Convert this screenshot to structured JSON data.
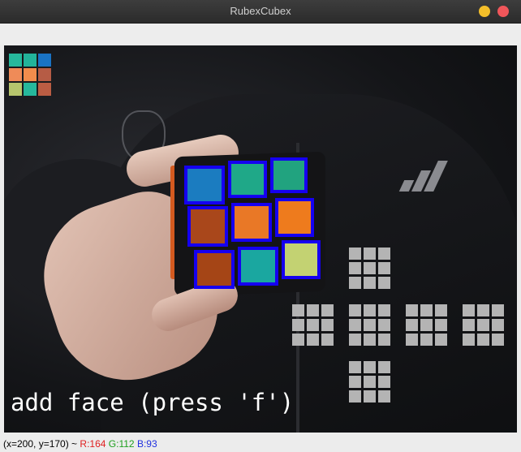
{
  "window": {
    "title": "RubexCubex"
  },
  "overlay": {
    "prompt": "add face (press 'f')"
  },
  "status": {
    "coords": "(x=200, y=170) ~",
    "r": "R:164",
    "g": "G:112",
    "b": "B:93"
  },
  "live_preview": {
    "colors": [
      "#26b89c",
      "#22b39a",
      "#1a73c4",
      "#ef8b58",
      "#f28c4c",
      "#b65c45",
      "#b6c56d",
      "#26b89c",
      "#bb5d43"
    ]
  },
  "detected_stickers": {
    "colors": [
      "#1b7cc0",
      "#1fa888",
      "#21a37f",
      "#a9471b",
      "#e97826",
      "#ee7b1d",
      "#a54516",
      "#1aa7a0",
      "#c3d272"
    ]
  },
  "net_color": "#b4b4b4",
  "icons": [
    "close-icon",
    "minimize-icon"
  ]
}
